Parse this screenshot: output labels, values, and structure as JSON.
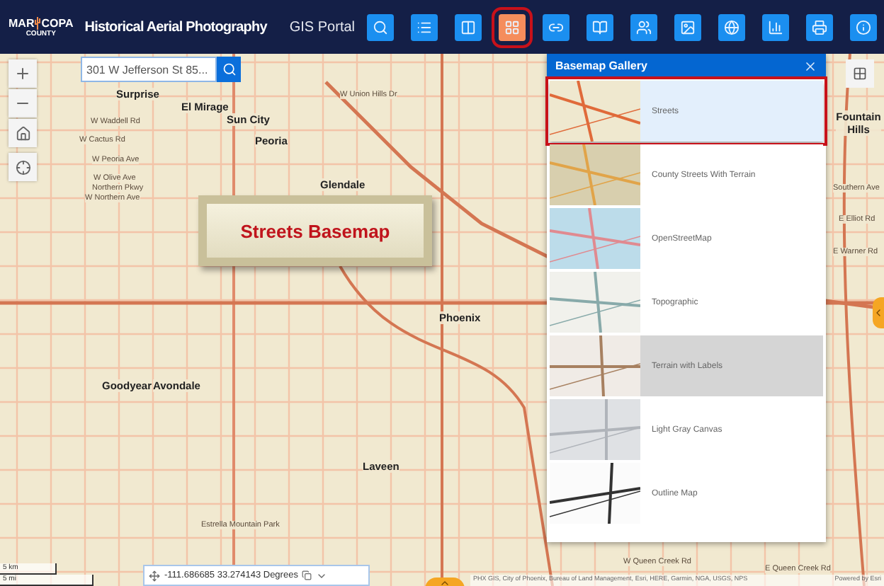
{
  "header": {
    "logo": {
      "left": "MAR",
      "right": "COPA",
      "bottom": "COUNTY"
    },
    "title": "Historical Aerial Photography",
    "portal_link": "GIS Portal"
  },
  "toolbar": [
    {
      "selected": false
    },
    {
      "selected": false
    },
    {
      "selected": false
    },
    {
      "selected": true
    },
    {
      "selected": false
    },
    {
      "selected": false
    },
    {
      "selected": false
    },
    {
      "selected": false
    },
    {
      "selected": false
    },
    {
      "selected": false
    },
    {
      "selected": false
    },
    {
      "selected": false
    }
  ],
  "search": {
    "value": "301 W Jefferson St 85..."
  },
  "map_labels": [
    {
      "text": "Surprise"
    },
    {
      "text": "El Mirage"
    },
    {
      "text": "Sun City"
    },
    {
      "text": "Peoria"
    },
    {
      "text": "W Waddell Rd"
    },
    {
      "text": "W Cactus Rd"
    },
    {
      "text": "W Peoria Ave"
    },
    {
      "text": "W Olive Ave"
    },
    {
      "text": "Northern Pkwy"
    },
    {
      "text": "W Northern Ave"
    },
    {
      "text": "Glendale"
    },
    {
      "text": "Phoenix"
    },
    {
      "text": "Goodyear"
    },
    {
      "text": "Avondale"
    },
    {
      "text": "Laveen"
    },
    {
      "text": "Estrella Mountain Park"
    },
    {
      "text": "Fountain Hills"
    },
    {
      "text": "W Union Hills Dr"
    },
    {
      "text": "W Queen Creek Rd"
    },
    {
      "text": "E Queen Creek Rd"
    },
    {
      "text": "Southern Ave"
    },
    {
      "text": "E Elliot Rd"
    },
    {
      "text": "E Warner Rd"
    }
  ],
  "callout": {
    "text": "Streets Basemap"
  },
  "basemap_gallery": {
    "title": "Basemap Gallery",
    "items": [
      {
        "label": "Streets",
        "selected": true,
        "hovered": false
      },
      {
        "label": "County Streets With Terrain",
        "selected": false,
        "hovered": false
      },
      {
        "label": "OpenStreetMap",
        "selected": false,
        "hovered": false
      },
      {
        "label": "Topographic",
        "selected": false,
        "hovered": false
      },
      {
        "label": "Terrain with Labels",
        "selected": false,
        "hovered": true
      },
      {
        "label": "Light Gray Canvas",
        "selected": false,
        "hovered": false
      },
      {
        "label": "Outline Map",
        "selected": false,
        "hovered": false
      }
    ]
  },
  "scale": {
    "metric": "5 km",
    "imperial": "5 mi"
  },
  "coordinates": {
    "value": "-111.686685 33.274143 Degrees"
  },
  "attribution": {
    "sources": "PHX GIS, City of Phoenix, Bureau of Land Management, Esri, HERE, Garmin, NGA, USGS, NPS",
    "powered_by": "Powered by Esri"
  }
}
